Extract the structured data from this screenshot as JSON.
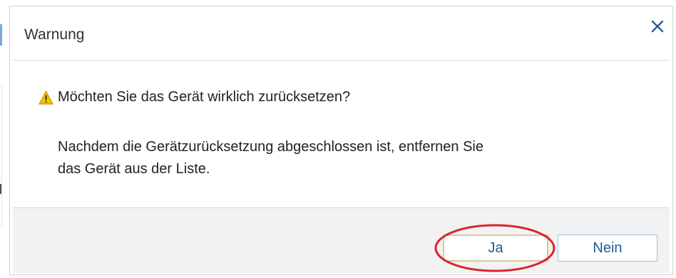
{
  "dialog": {
    "title": "Warnung",
    "close_glyph": "×",
    "message": {
      "question": "Möchten Sie das Gerät wirklich zurücksetzen?",
      "detail_line1": "Nachdem die Gerätzurücksetzung abgeschlossen ist, entfernen Sie",
      "detail_line2": "das Gerät aus der Liste."
    },
    "buttons": {
      "yes_label": "Ja",
      "no_label": "Nein"
    },
    "icons": {
      "warning": "warning-icon",
      "close": "close-icon"
    },
    "colors": {
      "accent_blue": "#1f5a94",
      "warning_yellow": "#f5c400",
      "annotation_red": "#d9262c",
      "footer_bg": "#f2f2f2"
    }
  }
}
